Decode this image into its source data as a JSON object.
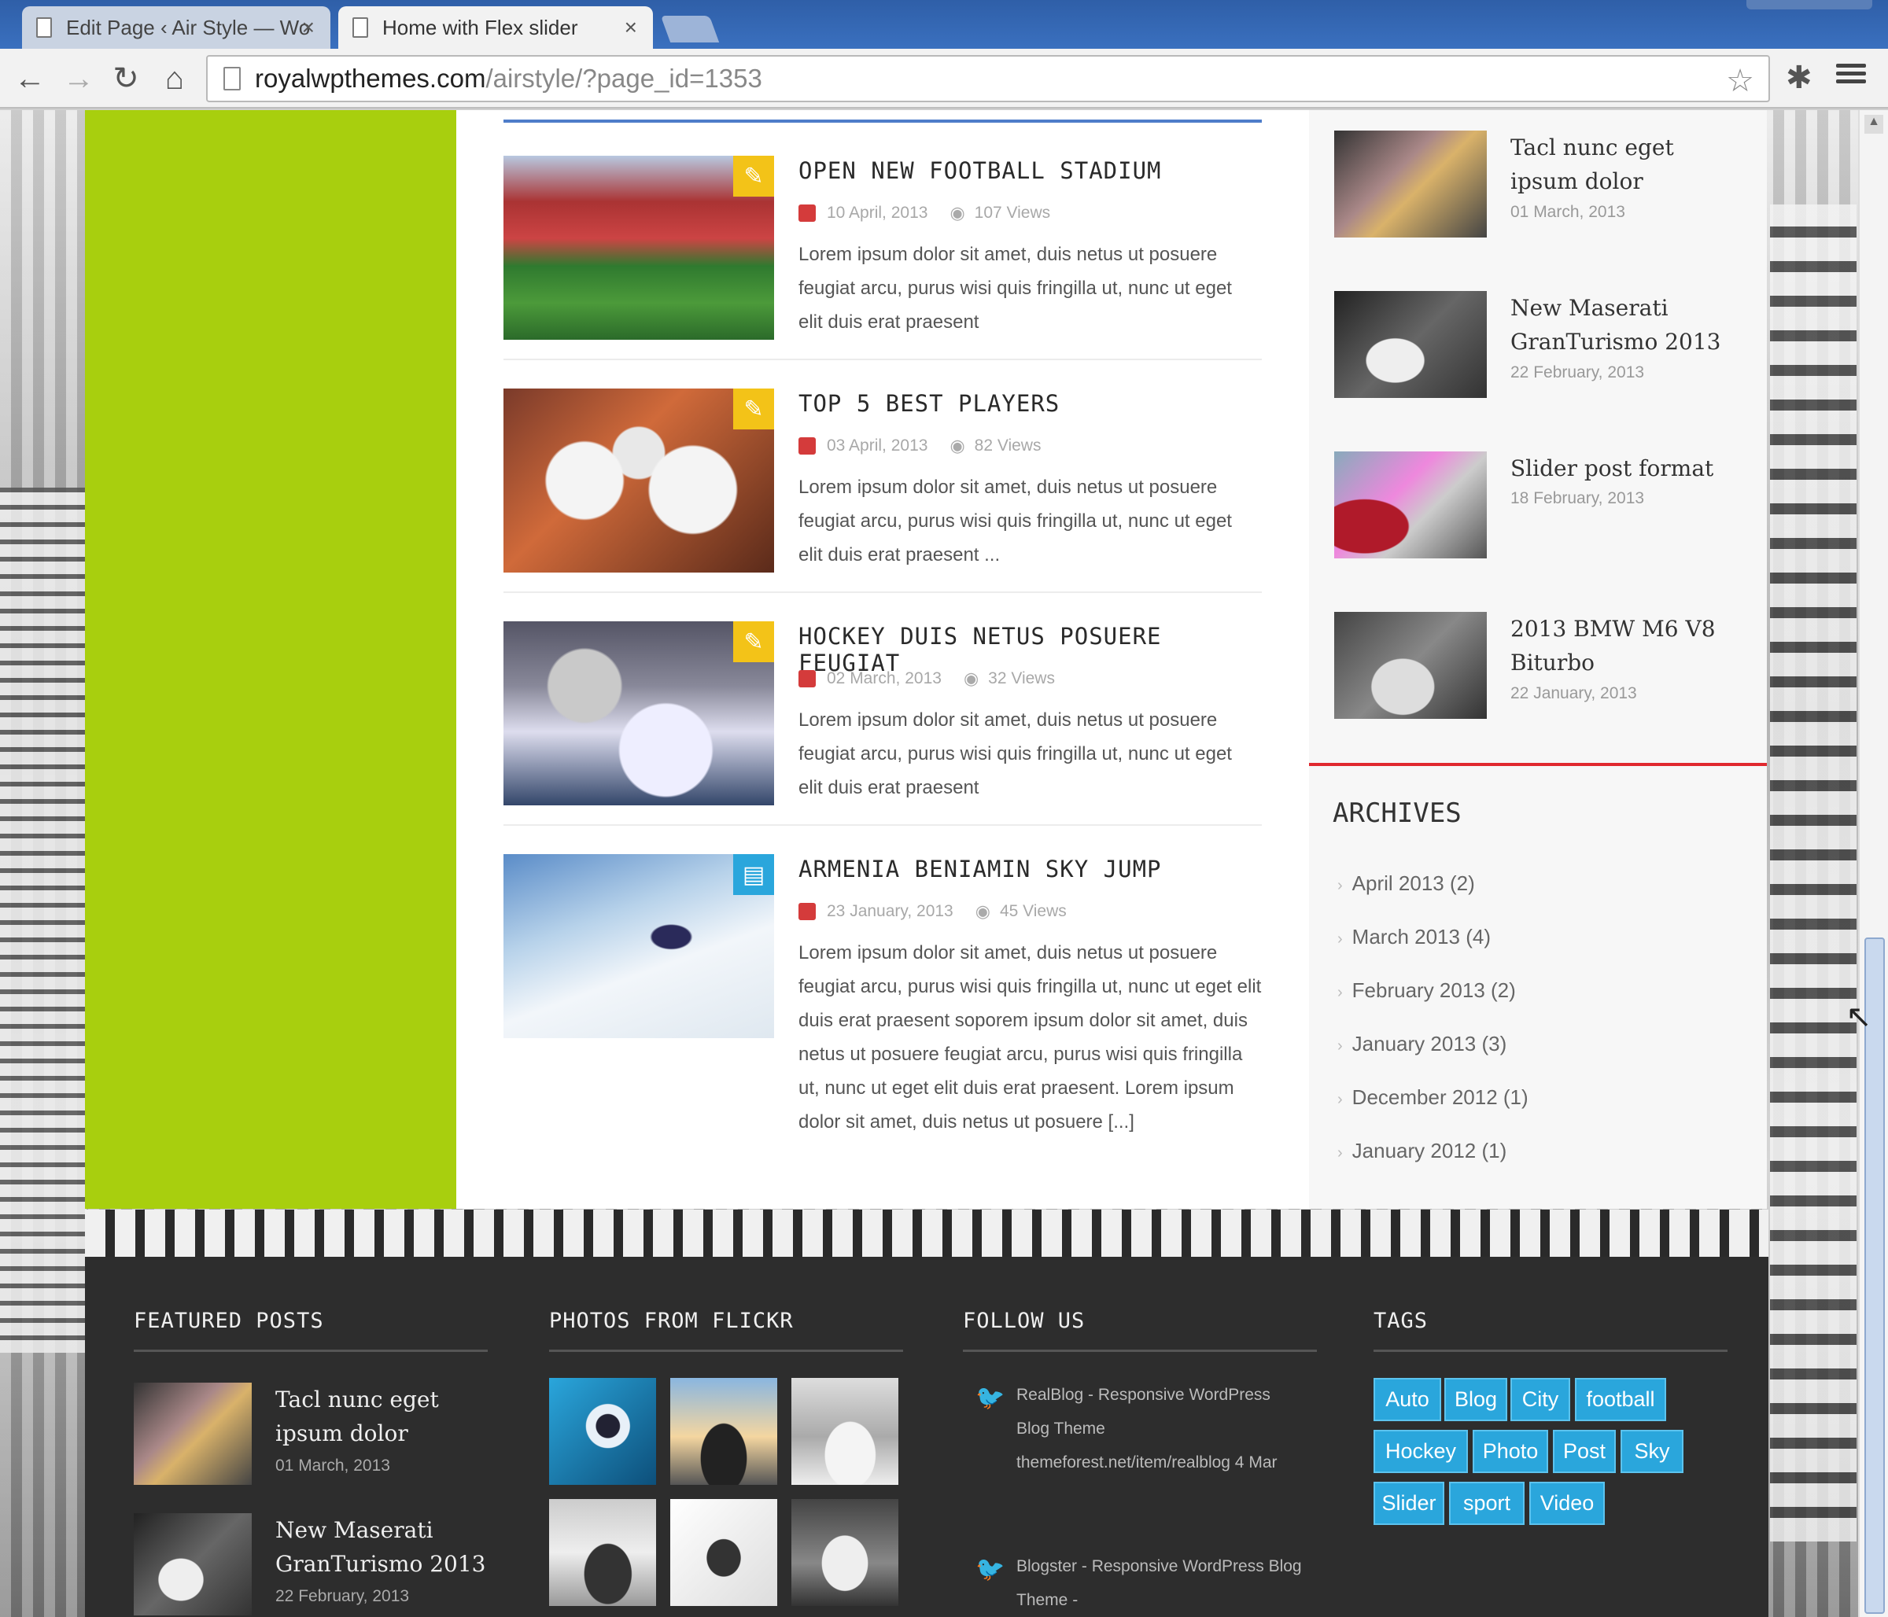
{
  "browser": {
    "tabs": [
      {
        "title": "Edit Page ‹ Air Style — Wo",
        "close": "×"
      },
      {
        "title": "Home with Flex slider",
        "close": "×"
      }
    ],
    "address": {
      "host": "royalwpthemes.com",
      "path": "/airstyle/?page_id=1353"
    },
    "icons": {
      "back": "←",
      "forward": "→",
      "reload": "↻",
      "home": "⌂",
      "star": "☆",
      "extension": "✱"
    }
  },
  "posts": [
    {
      "title": "OPEN NEW FOOTBALL STADIUM",
      "date": "10 April, 2013",
      "views": "107 Views",
      "excerpt": "Lorem ipsum dolor sit amet, duis netus ut posuere feugiat arcu, purus wisi quis fringilla ut, nunc ut eget elit duis erat praesent",
      "format_icon": "✎"
    },
    {
      "title": "TOP 5 BEST PLAYERS",
      "date": "03 April, 2013",
      "views": "82 Views",
      "excerpt": "Lorem ipsum dolor sit amet, duis netus ut posuere feugiat arcu, purus wisi quis fringilla ut, nunc ut eget elit duis erat praesent ...",
      "format_icon": "✎"
    },
    {
      "title": "HOCKEY DUIS NETUS POSUERE FEUGIAT",
      "date": "02 March, 2013",
      "views": "32 Views",
      "excerpt": "Lorem ipsum dolor sit amet, duis netus ut posuere feugiat arcu, purus wisi quis fringilla ut, nunc ut eget elit duis erat praesent",
      "format_icon": "✎"
    },
    {
      "title": "ARMENIA BENIAMIN SKY JUMP",
      "date": "23 January, 2013",
      "views": "45 Views",
      "excerpt": "Lorem ipsum dolor sit amet, duis netus ut posuere feugiat arcu, purus wisi quis fringilla ut, nunc ut eget elit duis erat praesent soporem ipsum dolor sit amet, duis netus ut posuere feugiat arcu, purus wisi quis fringilla ut, nunc ut eget elit duis erat praesent. Lorem ipsum dolor sit amet, duis netus ut posuere [...]",
      "format_icon": "▤"
    }
  ],
  "sidebar": {
    "posts": [
      {
        "title": "Tacl nunc eget ipsum dolor",
        "date": "01 March, 2013"
      },
      {
        "title": "New Maserati GranTurismo 2013",
        "date": "22 February, 2013"
      },
      {
        "title": "Slider post format",
        "date": "18 February, 2013"
      },
      {
        "title": "2013 BMW M6 V8 Biturbo",
        "date": "22 January, 2013"
      }
    ],
    "archives_title": "ARCHIVES",
    "archives": [
      "April 2013 (2)",
      "March 2013 (4)",
      "February 2013 (2)",
      "January 2013 (3)",
      "December 2012 (1)",
      "January 2012 (1)"
    ]
  },
  "footer": {
    "featured_title": "FEATURED POSTS",
    "flickr_title": "PHOTOS FROM FLICKR",
    "follow_title": "FOLLOW US",
    "tags_title": "TAGS",
    "featured": [
      {
        "title": "Tacl nunc eget ipsum dolor",
        "date": "01 March, 2013"
      },
      {
        "title": "New Maserati GranTurismo 2013",
        "date": "22 February, 2013"
      }
    ],
    "tweets": [
      {
        "text": "RealBlog - Responsive WordPress Blog Theme themeforest.net/item/realblog 4 Mar"
      },
      {
        "text": "Blogster - Responsive WordPress Blog Theme -"
      }
    ],
    "tags": [
      "Auto",
      "Blog",
      "City",
      "football",
      "Hockey",
      "Photo",
      "Post",
      "Sky",
      "Slider",
      "sport",
      "Video"
    ]
  },
  "colors": {
    "accent_green": "#a8cf0e",
    "tag_blue": "#2aa6dc",
    "sidebar_red_rule": "#e0282e",
    "format_yellow": "#f3c318",
    "format_blue": "#2aa6dc"
  }
}
